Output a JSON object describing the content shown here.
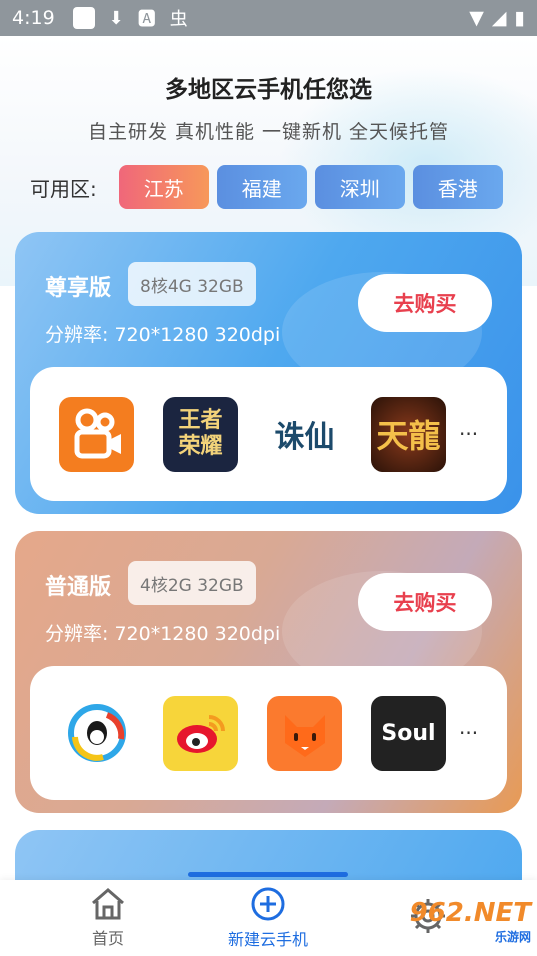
{
  "status_bar": {
    "time": "4:19"
  },
  "header": {
    "title": "多地区云手机任您选",
    "subtitle": "自主研发 真机性能 一键新机 全天候托管"
  },
  "regions": {
    "label": "可用区:",
    "items": [
      "江苏",
      "福建",
      "深圳",
      "香港"
    ],
    "selected": "江苏"
  },
  "plans": [
    {
      "tier": "尊享版",
      "spec": "8核4G 32GB",
      "resolution": "分辨率: 720*1280 320dpi",
      "buy_label": "去购买",
      "apps": [
        "kuaishou-icon",
        "wangzhe-rongyao-icon",
        "zhuxian-icon",
        "tianlong-icon"
      ],
      "app_text": {
        "wangzhe_line1": "王者",
        "wangzhe_line2": "荣耀",
        "zhuxian": "诛仙",
        "tianlong": "天龍"
      },
      "more": "···"
    },
    {
      "tier": "普通版",
      "spec": "4核2G 32GB",
      "resolution": "分辨率: 720*1280 320dpi",
      "buy_label": "去购买",
      "apps": [
        "qq-icon",
        "weibo-icon",
        "fox-icon",
        "soul-icon"
      ],
      "app_text": {
        "soul": "Soul"
      },
      "more": "···"
    }
  ],
  "nav": {
    "items": [
      {
        "label": "首页",
        "icon": "home-icon"
      },
      {
        "label": "新建云手机",
        "icon": "plus-circle-icon"
      },
      {
        "label": "",
        "icon": "gear-icon"
      }
    ],
    "active": 1
  },
  "watermark": {
    "text": "962.NET",
    "sub": "乐游网"
  },
  "colors": {
    "accent": "#1e6de0",
    "buy_text": "#e8404e",
    "region_active_from": "#f0677a",
    "region_active_to": "#f7985a",
    "region_default": "#5b8fe0"
  }
}
